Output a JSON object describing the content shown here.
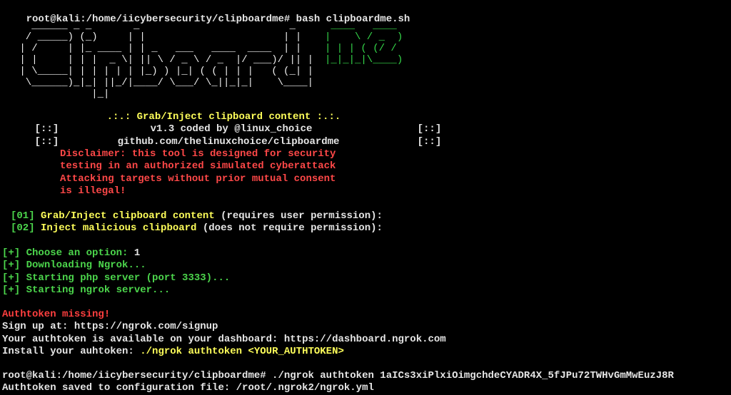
{
  "terminal": {
    "prompt1": "root@kali:/home/iicybersecurity/clipboardme# bash clipboardme.sh",
    "tagline": ".:.: Grab/Inject clipboard content :.:.",
    "bracket": "[::]",
    "version": "v1.3 coded by @linux_choice",
    "github": "github.com/thelinuxchoice/clipboardme",
    "disclaimer": [
      "Disclaimer: this tool is designed for security",
      "testing in an authorized simulated cyberattack",
      "Attacking targets without prior mutual consent",
      "is illegal!"
    ],
    "options": [
      {
        "num": "[01]",
        "label": "Grab/Inject clipboard content",
        "note": "(requires user permission):"
      },
      {
        "num": "[02]",
        "label": "Inject malicious clipboard",
        "note": "(does not require permission):"
      }
    ],
    "status": [
      {
        "mark": "[+]",
        "text": "Choose an option:",
        "value": "1"
      },
      {
        "mark": "[+]",
        "text": "Downloading Ngrok...",
        "value": ""
      },
      {
        "mark": "[+]",
        "text": "Starting php server (port 3333)...",
        "value": ""
      },
      {
        "mark": "[+]",
        "text": "Starting ngrok server...",
        "value": ""
      }
    ],
    "auth_missing": "Authtoken missing!",
    "signup": "Sign up at: https://ngrok.com/signup",
    "dashboard": "Your authtoken is available on your dashboard: https://dashboard.ngrok.com",
    "install_prefix": "Install your auhtoken: ",
    "install_cmd": "./ngrok authtoken <YOUR_AUTHTOKEN>",
    "prompt2": "root@kali:/home/iicybersecurity/clipboardme# ./ngrok authtoken 1aICs3xiPlxiOimgchdeCYADR4X_5fJPu72TWHvGmMwEuzJ8R",
    "saved": "Authtoken saved to configuration file: /root/.ngrok2/ngrok.yml"
  },
  "colors": {
    "background": "#000000",
    "text": "#e6e6e6",
    "yellow": "#ffff5a",
    "green": "#4cd64c",
    "red": "#ff4848"
  }
}
